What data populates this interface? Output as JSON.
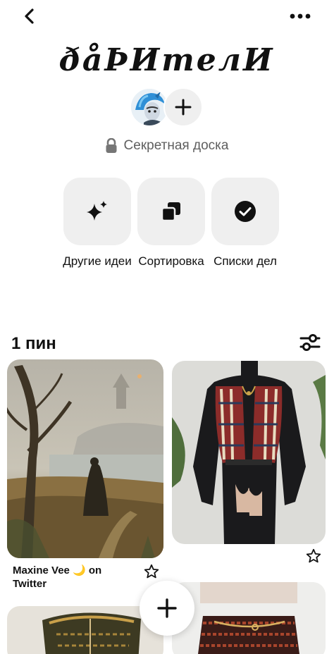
{
  "header": {
    "back_icon": "chevron-left-icon",
    "more_icon": "ellipsis-horizontal-icon"
  },
  "board": {
    "title": "ðåÞИтелИ",
    "privacy_label": "Секретная доска",
    "privacy_icon": "lock-icon"
  },
  "actions": [
    {
      "label": "Другие идеи",
      "icon": "sparkle-icon"
    },
    {
      "label": "Сортировка",
      "icon": "overlap-squares-icon"
    },
    {
      "label": "Списки дел",
      "icon": "check-circle-icon"
    }
  ],
  "pins_section": {
    "count_label": "1 пин",
    "filter_icon": "sliders-icon"
  },
  "pins": [
    {
      "caption": "Maxine Vee 🌙 on Twitter",
      "image": "misty-landscape-painting-image"
    },
    {
      "caption": "",
      "image": "knitted-vest-outfit-image"
    },
    {
      "caption": "",
      "image": "embroidered-corset-image"
    },
    {
      "caption": "",
      "image": "patterned-skirt-image"
    }
  ],
  "colors": {
    "tile_bg": "#efefef",
    "text": "#111111",
    "muted": "#5f5f5f"
  }
}
